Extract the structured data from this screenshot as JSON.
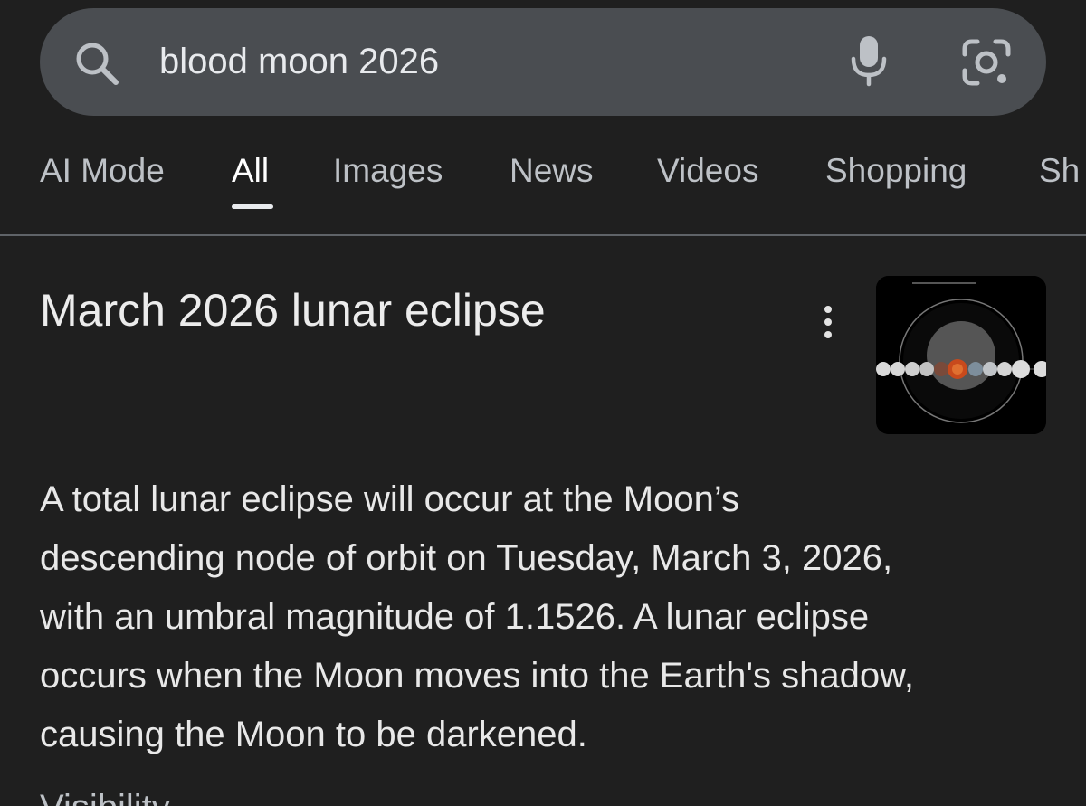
{
  "search": {
    "query": "blood moon 2026"
  },
  "tabs": [
    {
      "label": "AI Mode"
    },
    {
      "label": "All"
    },
    {
      "label": "Images"
    },
    {
      "label": "News"
    },
    {
      "label": "Videos"
    },
    {
      "label": "Shopping"
    },
    {
      "label": "Sh"
    }
  ],
  "active_tab": "All",
  "result": {
    "title": "March 2026 lunar eclipse",
    "description_lines": [
      "A total lunar eclipse will occur at the Moon’s",
      "descending node of orbit on Tuesday, March 3, 2026,",
      "with an umbral magnitude of 1.1526. A lunar eclipse",
      "occurs when the Moon moves into the Earth's shadow,",
      "causing the Moon to be darkened."
    ],
    "cut_off_line": "Visibility"
  },
  "colors": {
    "background": "#1f1f1f",
    "search_bar": "#4a4d51",
    "text_primary": "#e8eaed",
    "text_secondary": "#bdc1c6",
    "divider": "#5f6368"
  },
  "icons": [
    "search-icon",
    "microphone-icon",
    "camera-lens-icon",
    "more-vert-icon"
  ]
}
